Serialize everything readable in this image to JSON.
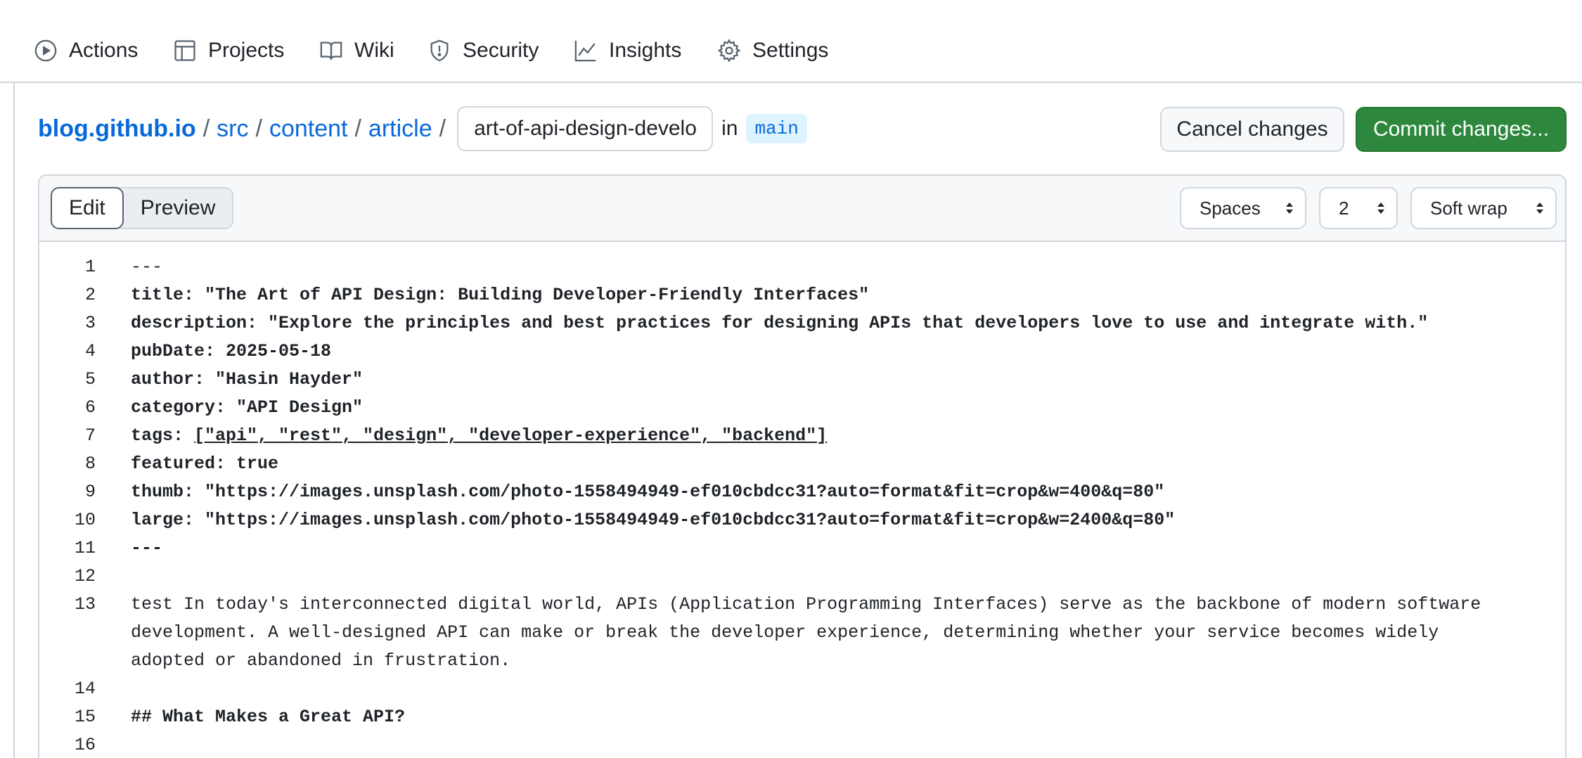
{
  "nav": {
    "items": [
      {
        "label": "Actions",
        "icon": "play-circle-icon"
      },
      {
        "label": "Projects",
        "icon": "table-icon"
      },
      {
        "label": "Wiki",
        "icon": "book-icon"
      },
      {
        "label": "Security",
        "icon": "shield-icon"
      },
      {
        "label": "Insights",
        "icon": "graph-icon"
      },
      {
        "label": "Settings",
        "icon": "gear-icon"
      }
    ]
  },
  "breadcrumb": {
    "repo": "blog.github.io",
    "segments": [
      "src",
      "content",
      "article"
    ],
    "separator": "/",
    "filename": "art-of-api-design-developer-friendly-interfaces.md",
    "in_label": "in",
    "branch": "main"
  },
  "actions": {
    "cancel_label": "Cancel changes",
    "commit_label": "Commit changes..."
  },
  "editor": {
    "tabs": {
      "edit": "Edit",
      "preview": "Preview",
      "active": "Edit"
    },
    "indent_mode": "Spaces",
    "indent_size": "2",
    "wrap_mode": "Soft wrap",
    "lines": [
      {
        "n": "1",
        "text": "---"
      },
      {
        "n": "2",
        "text": "title: \"The Art of API Design: Building Developer-Friendly Interfaces\""
      },
      {
        "n": "3",
        "text": "description: \"Explore the principles and best practices for designing APIs that developers love to use and integrate with.\""
      },
      {
        "n": "4",
        "text": "pubDate: 2025-05-18"
      },
      {
        "n": "5",
        "text": "author: \"Hasin Hayder\""
      },
      {
        "n": "6",
        "text": "category: \"API Design\""
      },
      {
        "n": "7",
        "text_prefix": "tags: ",
        "text_underlined": "[\"api\", \"rest\", \"design\", \"developer-experience\", \"backend\"]"
      },
      {
        "n": "8",
        "text": "featured: true"
      },
      {
        "n": "9",
        "text": "thumb: \"https://images.unsplash.com/photo-1558494949-ef010cbdcc31?auto=format&fit=crop&w=400&q=80\""
      },
      {
        "n": "10",
        "text": "large: \"https://images.unsplash.com/photo-1558494949-ef010cbdcc31?auto=format&fit=crop&w=2400&q=80\""
      },
      {
        "n": "11",
        "text": "---"
      },
      {
        "n": "12",
        "text": ""
      },
      {
        "n": "13",
        "text": "test In today's interconnected digital world, APIs (Application Programming Interfaces) serve as the backbone of modern software development. A well-designed API can make or break the developer experience, determining whether your service becomes widely adopted or abandoned in frustration."
      },
      {
        "n": "14",
        "text": ""
      },
      {
        "n": "15",
        "text": "## What Makes a Great API?"
      },
      {
        "n": "16",
        "text": ""
      }
    ]
  },
  "colors": {
    "link": "#0969da",
    "commit_green": "#2d883d",
    "border": "#d0d7de",
    "toolbar_bg": "#f6f8fa"
  }
}
